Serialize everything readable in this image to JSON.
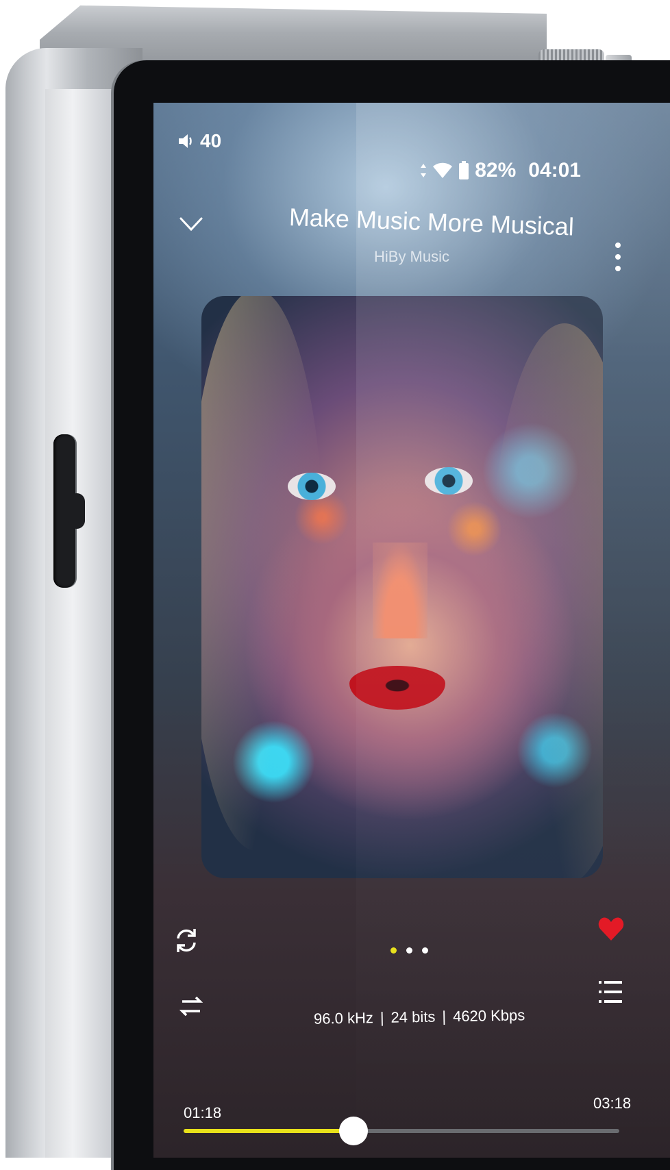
{
  "status_bar": {
    "volume": "40",
    "battery": "82%",
    "time": "04:01"
  },
  "now_playing": {
    "title": "Make Music More Musical",
    "artist": "HiBy Music",
    "page_indicator": {
      "count": 3,
      "active": 0
    },
    "liked": true,
    "format": {
      "sample_rate": "96.0 kHz",
      "bit_depth": "24 bits",
      "bitrate": "4620 Kbps",
      "separator": "|"
    },
    "elapsed": "01:18",
    "duration": "03:18",
    "progress_fraction": 0.39
  },
  "icons": {
    "collapse": "chevron-down-icon",
    "more": "more-vertical-icon",
    "repeat": "repeat-icon",
    "favorite": "heart-icon",
    "play_order": "play-order-icon",
    "queue": "playlist-icon",
    "speaker": "speaker-icon",
    "wifi": "wifi-icon",
    "battery": "battery-icon"
  },
  "colors": {
    "accent": "#e8e11a",
    "heart": "#e31622",
    "text": "#ffffff"
  }
}
